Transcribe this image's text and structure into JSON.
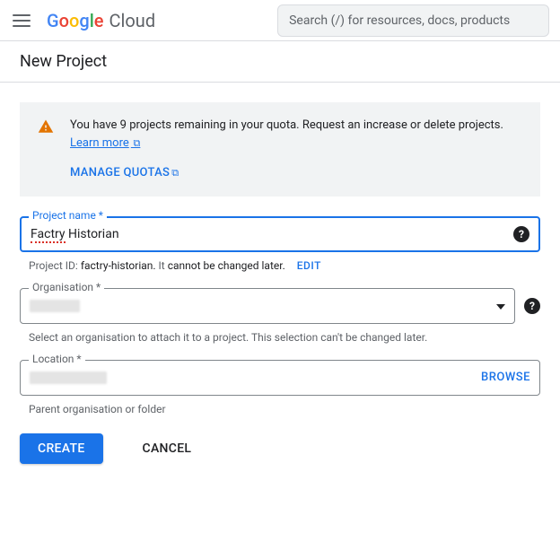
{
  "header": {
    "logo_google_letters": [
      "G",
      "o",
      "o",
      "g",
      "l",
      "e"
    ],
    "logo_cloud": "Cloud",
    "search_placeholder": "Search (/) for resources, docs, products"
  },
  "page_title": "New Project",
  "notice": {
    "text_before_link": "You have 9 projects remaining in your quota. Request an increase or delete projects. ",
    "learn_more": "Learn more",
    "manage_quotas": "MANAGE QUOTAS"
  },
  "project_name": {
    "label": "Project name *",
    "value_misspelled": "Factry",
    "value_rest": " Historian"
  },
  "project_id_line": {
    "prefix": "Project ID: ",
    "id_value": "factry-historian.",
    "suffix_1": " It ",
    "suffix_strong": "cannot be changed later.",
    "edit": "EDIT"
  },
  "organisation": {
    "label": "Organisation *",
    "helper": "Select an organisation to attach it to a project. This selection can't be changed later."
  },
  "location": {
    "label": "Location *",
    "browse": "BROWSE",
    "helper": "Parent organisation or folder"
  },
  "actions": {
    "create": "CREATE",
    "cancel": "CANCEL"
  },
  "google_colors": [
    "#4285F4",
    "#EA4335",
    "#FBBC05",
    "#4285F4",
    "#34A853",
    "#EA4335"
  ]
}
